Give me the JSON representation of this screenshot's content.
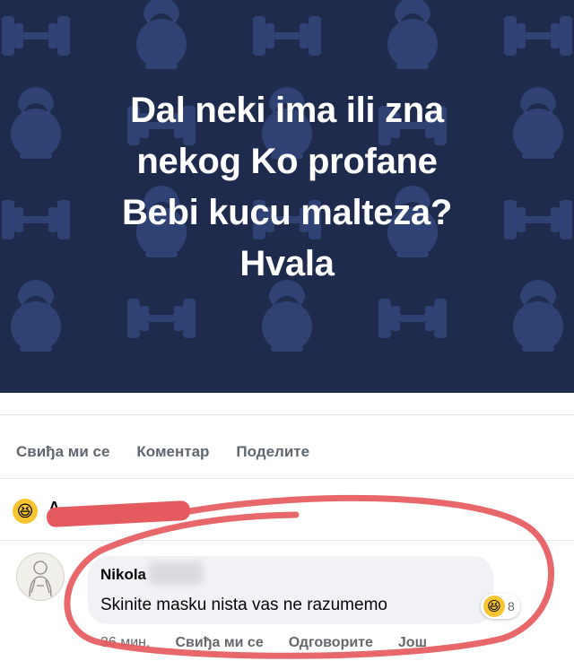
{
  "post": {
    "lines": [
      "Dal neki ima ili zna",
      "nekog Ko profane",
      "Bebi kucu malteza?",
      "Hvala"
    ],
    "background_color": "#1f2b4d",
    "pattern_icons": [
      "dumbbell-icon",
      "kettlebell-icon"
    ]
  },
  "actions": {
    "like_label": "Свиђа ми се",
    "comment_label": "Коментар",
    "share_label": "Поделите"
  },
  "reactions": {
    "emoji_icon": "laughing-face-icon",
    "name_initial": "A"
  },
  "comment": {
    "author": "Nikola",
    "text": "Skinite masku nista vas ne razumemo",
    "reaction_emoji": "laughing-face-icon",
    "reaction_count": "8",
    "time": "36 мин.",
    "like_label": "Свиђа ми се",
    "reply_label": "Одговорите",
    "more_label": "Још"
  },
  "annotation_color": "#e55a5e"
}
